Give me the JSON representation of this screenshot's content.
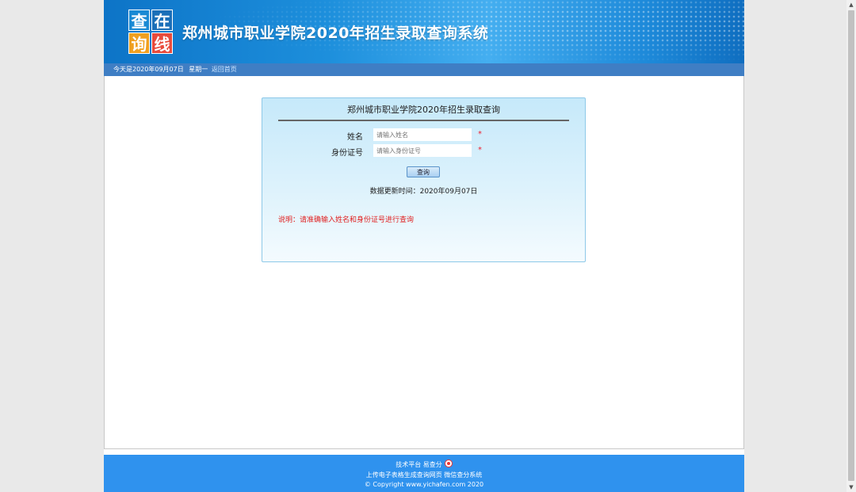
{
  "header": {
    "logo_chars": [
      "查",
      "在",
      "询",
      "线"
    ],
    "title": "郑州城市职业学院2020年招生录取查询系统"
  },
  "datebar": {
    "today": "今天是2020年09月07日",
    "weekday": "星期一",
    "home_link": "返回首页"
  },
  "form": {
    "title": "郑州城市职业学院2020年招生录取查询",
    "name_label": "姓名",
    "name_placeholder": "请输入姓名",
    "id_label": "身份证号",
    "id_placeholder": "请输入身份证号",
    "required_mark": "*",
    "query_button": "查询",
    "update_time": "数据更新时间：2020年09月07日",
    "note": "说明：请准确输入姓名和身份证号进行查询"
  },
  "footer": {
    "line1": "技术平台 易查分",
    "line2": "上传电子表格生成查询网页 微信查分系统",
    "line3": "© Copyright www.yichafen.com 2020"
  },
  "colors": {
    "header_blue": "#1d8fdc",
    "footer_blue": "#2f92ee",
    "note_red": "#e02020"
  }
}
